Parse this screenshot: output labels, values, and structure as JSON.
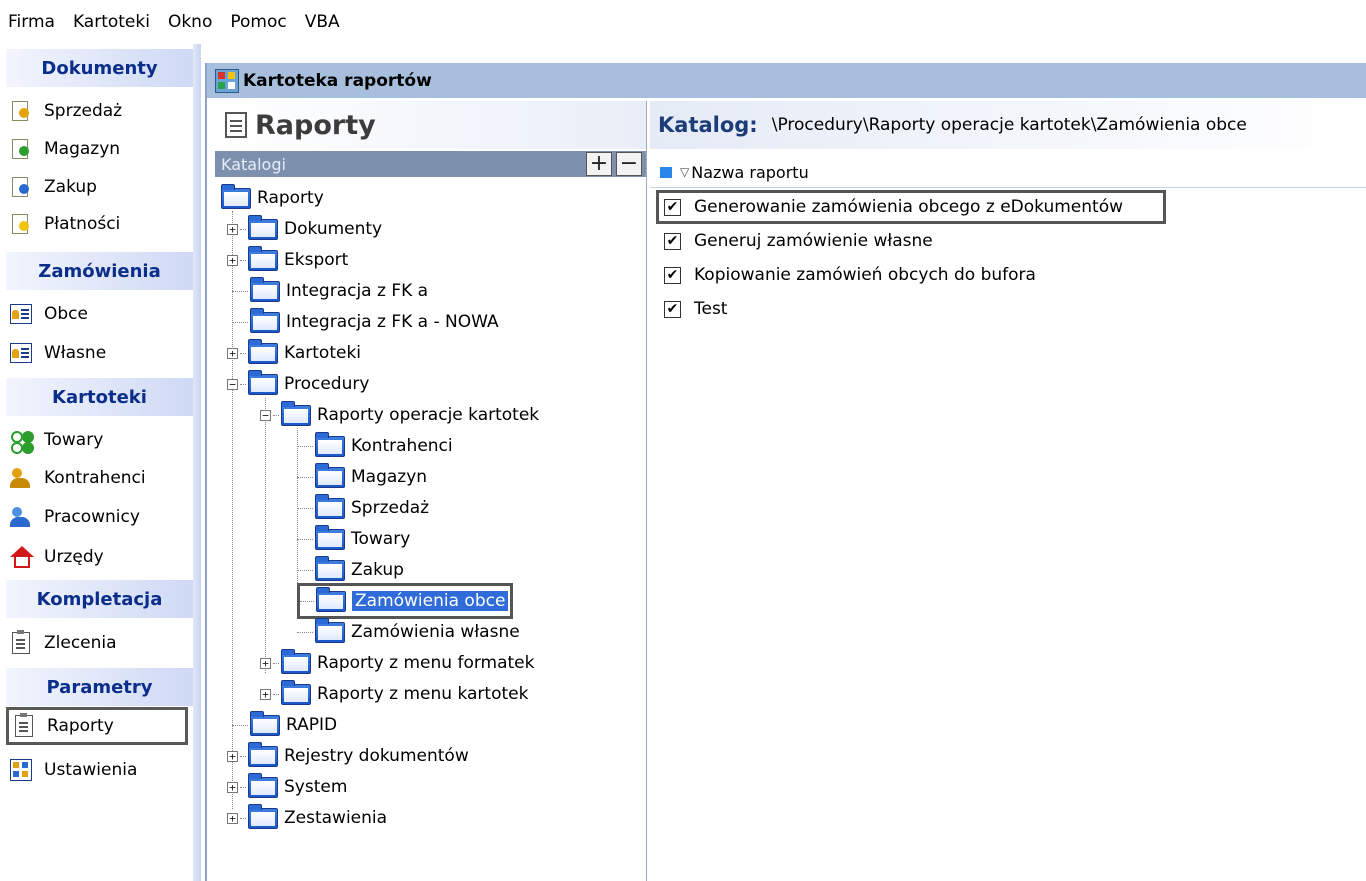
{
  "menu": [
    "Firma",
    "Kartoteki",
    "Okno",
    "Pomoc",
    "VBA"
  ],
  "nav": {
    "groups": [
      {
        "title": "Dokumenty",
        "items": [
          "Sprzedaż",
          "Magazyn",
          "Zakup",
          "Płatności"
        ]
      },
      {
        "title": "Zamówienia",
        "items": [
          "Obce",
          "Własne"
        ]
      },
      {
        "title": "Kartoteki",
        "items": [
          "Towary",
          "Kontrahenci",
          "Pracownicy",
          "Urzędy"
        ]
      },
      {
        "title": "Kompletacja",
        "items": [
          "Zlecenia"
        ]
      },
      {
        "title": "Parametry",
        "items": [
          "Raporty",
          "Ustawienia"
        ]
      }
    ]
  },
  "window": {
    "title": "Kartoteka raportów",
    "left_title": "Raporty",
    "catalog_label": "Katalogi",
    "add_btn": "+",
    "remove_btn": "−",
    "tree": {
      "root": "Raporty",
      "n1": "Dokumenty",
      "n2": "Eksport",
      "n3": "Integracja z FK a",
      "n4": "Integracja z FK a - NOWA",
      "n5": "Kartoteki",
      "n6": "Procedury",
      "n6a": "Raporty operacje kartotek",
      "n6a1": "Kontrahenci",
      "n6a2": "Magazyn",
      "n6a3": "Sprzedaż",
      "n6a4": "Towary",
      "n6a5": "Zakup",
      "n6a6": "Zamówienia obce",
      "n6a7": "Zamówienia własne",
      "n6b": "Raporty z menu formatek",
      "n6c": "Raporty z menu kartotek",
      "n7": "RAPID",
      "n8": "Rejestry dokumentów",
      "n9": "System",
      "n10": "Zestawienia"
    },
    "path_label": "Katalog:",
    "path_value": "\\Procedury\\Raporty operacje kartotek\\Zamówienia obce",
    "column_header": "Nazwa raportu",
    "reports": [
      "Generowanie zamówienia obcego z eDokumentów",
      "Generuj zamówienie własne",
      "Kopiowanie zamówień obcych do bufora",
      "Test"
    ],
    "check": "✔"
  }
}
